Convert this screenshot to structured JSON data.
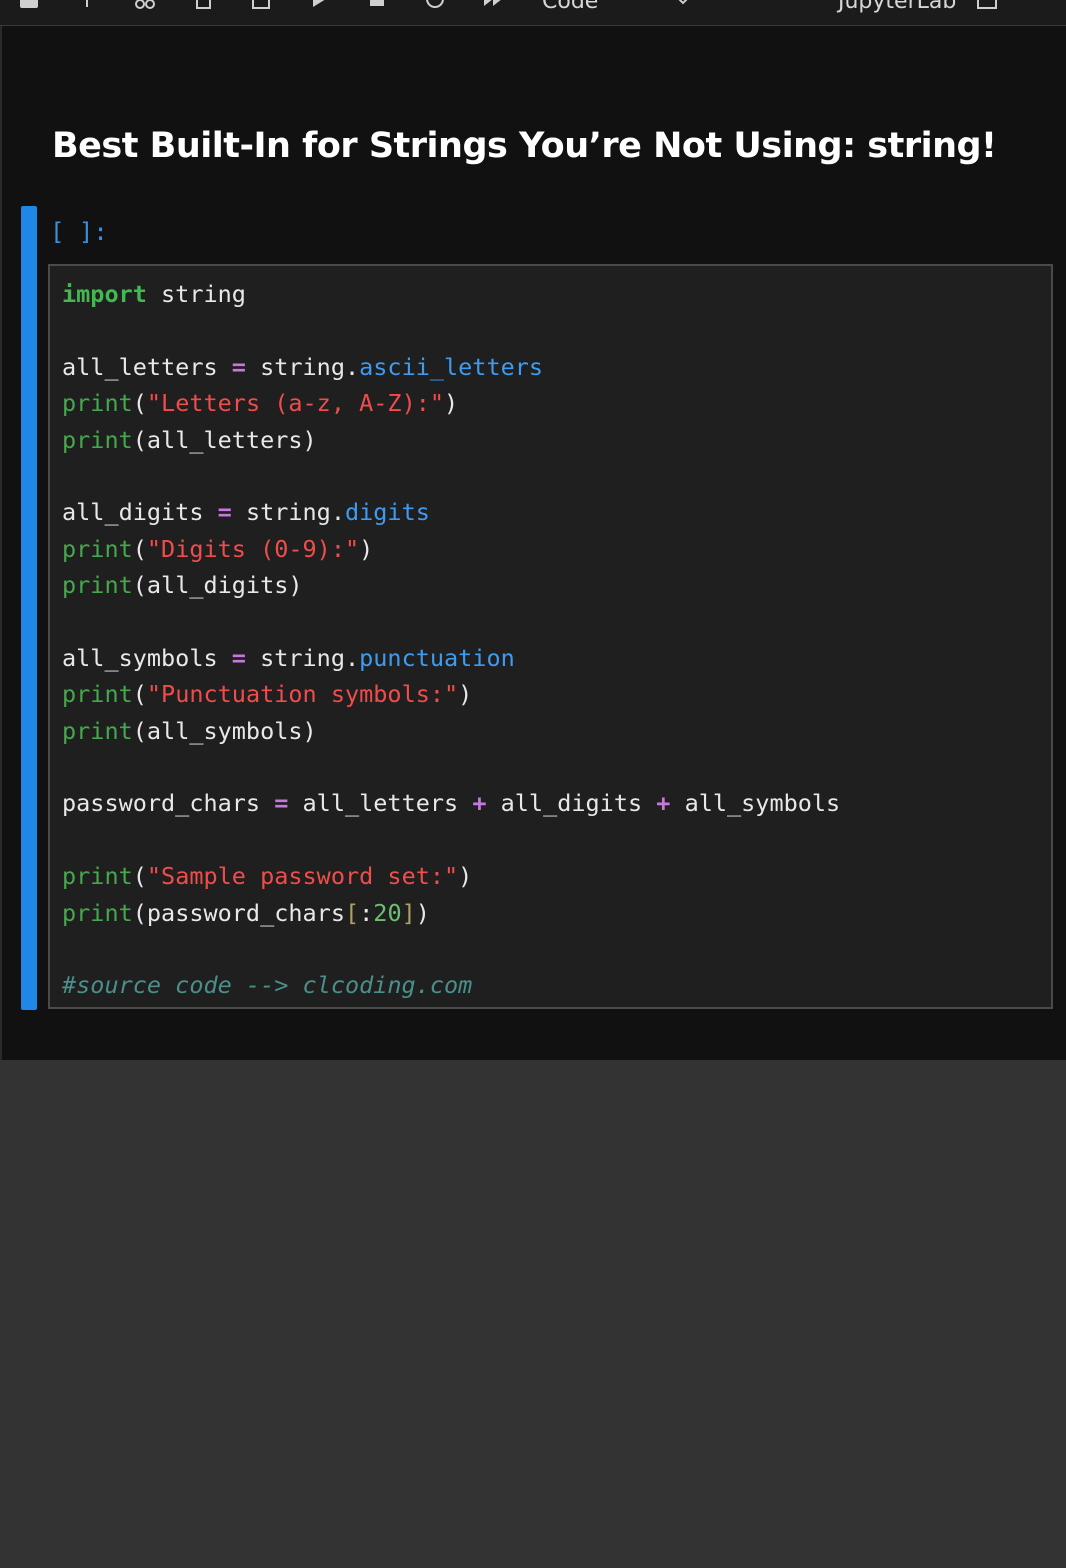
{
  "toolbar": {
    "cell_type": "Code",
    "kernel_label": "JupyterLab"
  },
  "notebook": {
    "title": "Best Built-In for Strings You’re Not Using: string!",
    "cell": {
      "prompt": "[ ]:",
      "lines": [
        [
          {
            "t": "import",
            "c": "kw"
          },
          {
            "t": " string",
            "c": "plain"
          }
        ],
        [],
        [
          {
            "t": "all_letters ",
            "c": "plain"
          },
          {
            "t": "=",
            "c": "op"
          },
          {
            "t": " string.",
            "c": "plain"
          },
          {
            "t": "ascii_letters",
            "c": "attr"
          }
        ],
        [
          {
            "t": "print",
            "c": "bi"
          },
          {
            "t": "(",
            "c": "plain"
          },
          {
            "t": "\"Letters (a-z, A-Z):\"",
            "c": "str"
          },
          {
            "t": ")",
            "c": "plain"
          }
        ],
        [
          {
            "t": "print",
            "c": "bi"
          },
          {
            "t": "(all_letters)",
            "c": "plain"
          }
        ],
        [],
        [
          {
            "t": "all_digits ",
            "c": "plain"
          },
          {
            "t": "=",
            "c": "op"
          },
          {
            "t": " string.",
            "c": "plain"
          },
          {
            "t": "digits",
            "c": "attr"
          }
        ],
        [
          {
            "t": "print",
            "c": "bi"
          },
          {
            "t": "(",
            "c": "plain"
          },
          {
            "t": "\"Digits (0-9):\"",
            "c": "str"
          },
          {
            "t": ")",
            "c": "plain"
          }
        ],
        [
          {
            "t": "print",
            "c": "bi"
          },
          {
            "t": "(all_digits)",
            "c": "plain"
          }
        ],
        [],
        [
          {
            "t": "all_symbols ",
            "c": "plain"
          },
          {
            "t": "=",
            "c": "op"
          },
          {
            "t": " string.",
            "c": "plain"
          },
          {
            "t": "punctuation",
            "c": "attr"
          }
        ],
        [
          {
            "t": "print",
            "c": "bi"
          },
          {
            "t": "(",
            "c": "plain"
          },
          {
            "t": "\"Punctuation symbols:\"",
            "c": "str"
          },
          {
            "t": ")",
            "c": "plain"
          }
        ],
        [
          {
            "t": "print",
            "c": "bi"
          },
          {
            "t": "(all_symbols)",
            "c": "plain"
          }
        ],
        [],
        [
          {
            "t": "password_chars ",
            "c": "plain"
          },
          {
            "t": "=",
            "c": "op"
          },
          {
            "t": " all_letters ",
            "c": "plain"
          },
          {
            "t": "+",
            "c": "op"
          },
          {
            "t": " all_digits ",
            "c": "plain"
          },
          {
            "t": "+",
            "c": "op"
          },
          {
            "t": " all_symbols",
            "c": "plain"
          }
        ],
        [],
        [
          {
            "t": "print",
            "c": "bi"
          },
          {
            "t": "(",
            "c": "plain"
          },
          {
            "t": "\"Sample password set:\"",
            "c": "str"
          },
          {
            "t": ")",
            "c": "plain"
          }
        ],
        [
          {
            "t": "print",
            "c": "bi"
          },
          {
            "t": "(password_chars",
            "c": "plain"
          },
          {
            "t": "[",
            "c": "brk"
          },
          {
            "t": ":",
            "c": "plain"
          },
          {
            "t": "20",
            "c": "num"
          },
          {
            "t": "]",
            "c": "brk"
          },
          {
            "t": ")",
            "c": "plain"
          }
        ],
        [],
        [
          {
            "t": "#source code --> clcoding.com",
            "c": "cmt"
          }
        ]
      ]
    }
  },
  "colors": {
    "cell_active_bar": "#1f87e6",
    "keyword": "#3fb950",
    "builtin": "#44a84d",
    "string": "#f14c4c",
    "operator": "#c678dd",
    "attribute": "#3e9bf0",
    "comment": "#4a8f8a"
  }
}
